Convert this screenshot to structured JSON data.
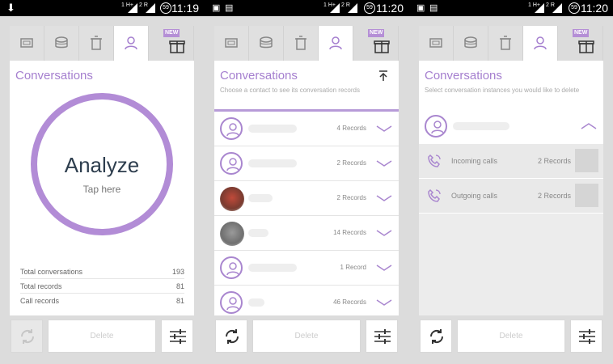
{
  "screens": [
    {
      "time": "11:19",
      "title": "Conversations",
      "analyze": {
        "label": "Analyze",
        "hint": "Tap here"
      },
      "stats": [
        {
          "label": "Total conversations",
          "value": "193"
        },
        {
          "label": "Total records",
          "value": "81"
        },
        {
          "label": "Call records",
          "value": "81"
        }
      ],
      "delete_label": "Delete",
      "new_badge": "NEW"
    },
    {
      "time": "11:20",
      "title": "Conversations",
      "subtitle": "Choose a contact to see its conversation records",
      "contacts": [
        {
          "records": "4 Records"
        },
        {
          "records": "2 Records"
        },
        {
          "records": "2 Records"
        },
        {
          "records": "14 Records"
        },
        {
          "records": "1 Record"
        },
        {
          "records": "46 Records"
        }
      ],
      "delete_label": "Delete",
      "new_badge": "NEW"
    },
    {
      "time": "11:20",
      "title": "Conversations",
      "subtitle": "Select conversation instances you would like to delete",
      "calls": [
        {
          "label": "Incoming calls",
          "records": "2 Records"
        },
        {
          "label": "Outgoing calls",
          "records": "2 Records"
        }
      ],
      "delete_label": "Delete",
      "new_badge": "NEW"
    }
  ],
  "colors": {
    "accent": "#b28cd6",
    "title": "#a57fcf",
    "background": "#dcdcdc"
  },
  "icons": [
    "cpu-icon",
    "database-icon",
    "trash-icon",
    "person-icon",
    "gift-icon",
    "refresh-icon",
    "sliders-icon",
    "phone-call-icon"
  ]
}
